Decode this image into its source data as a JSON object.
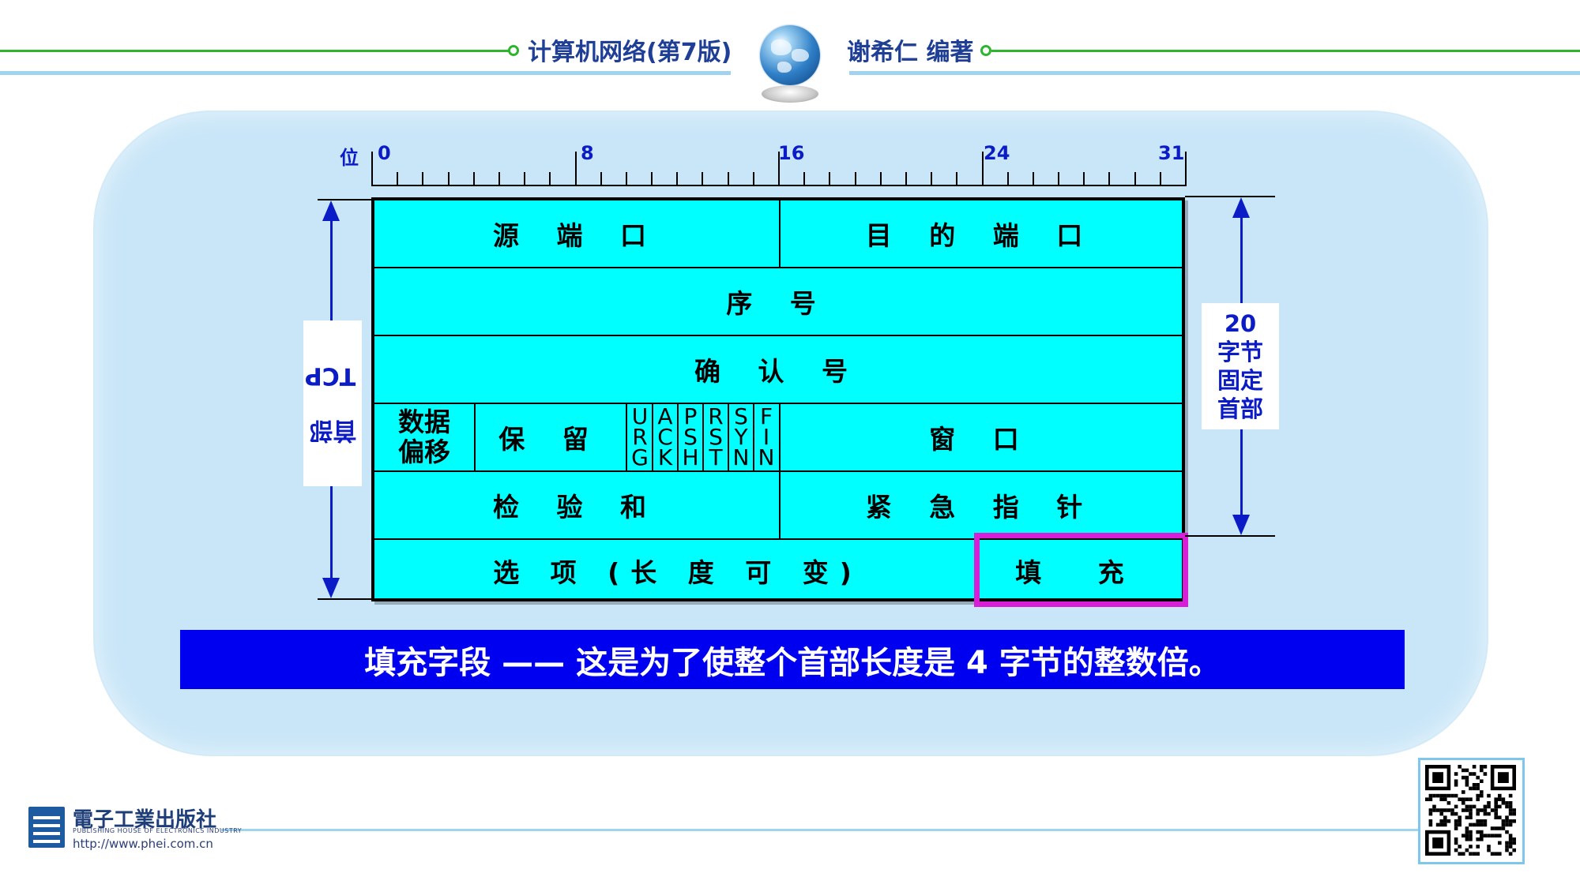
{
  "header": {
    "book_title": "计算机网络(第7版)",
    "author": "谢希仁 编著",
    "colors": {
      "accent_green": "#2db52d",
      "line_blue": "#9fd3ef",
      "title_blue": "#1f3f96"
    }
  },
  "ruler": {
    "unit_label": "位",
    "bit_labels": [
      "0",
      "8",
      "16",
      "24",
      "31"
    ]
  },
  "tcp_header": {
    "rows": [
      {
        "fields": [
          "源 端 口",
          "目 的 端 口"
        ]
      },
      {
        "fields": [
          "序 号"
        ]
      },
      {
        "fields": [
          "确 认 号"
        ]
      },
      {
        "data_offset": "数据\n偏移",
        "reserved": "保 留",
        "window": "窗 口",
        "flags": [
          [
            "U",
            "R",
            "G"
          ],
          [
            "A",
            "C",
            "K"
          ],
          [
            "P",
            "S",
            "H"
          ],
          [
            "R",
            "S",
            "T"
          ],
          [
            "S",
            "Y",
            "N"
          ],
          [
            "F",
            "I",
            "N"
          ]
        ]
      },
      {
        "fields": [
          "检 验 和",
          "紧 急 指 针"
        ]
      },
      {
        "fields": [
          "选 项 (长 度 可 变)",
          "填 充"
        ]
      }
    ],
    "highlight_field": "填 充",
    "colors": {
      "field_fill": "#00ffff",
      "highlight_border": "#d61fd6"
    }
  },
  "annotations": {
    "left_label_line1": "TCP",
    "left_label_line2": "首部",
    "right_label_lines": [
      "20",
      "字节",
      "固定",
      "首部"
    ],
    "arrow_color": "#0b1cc7"
  },
  "banner": {
    "text": "填充字段 —— 这是为了使整个首部长度是 4 字节的整数倍。",
    "background": "#0000f0"
  },
  "footer": {
    "publisher_name": "電子工業出版社",
    "publisher_en": "PUBLISHING HOUSE OF ELECTRONICS INDUSTRY",
    "publisher_url": "http://www.phei.com.cn",
    "qr_icon": "qr-code-icon"
  }
}
